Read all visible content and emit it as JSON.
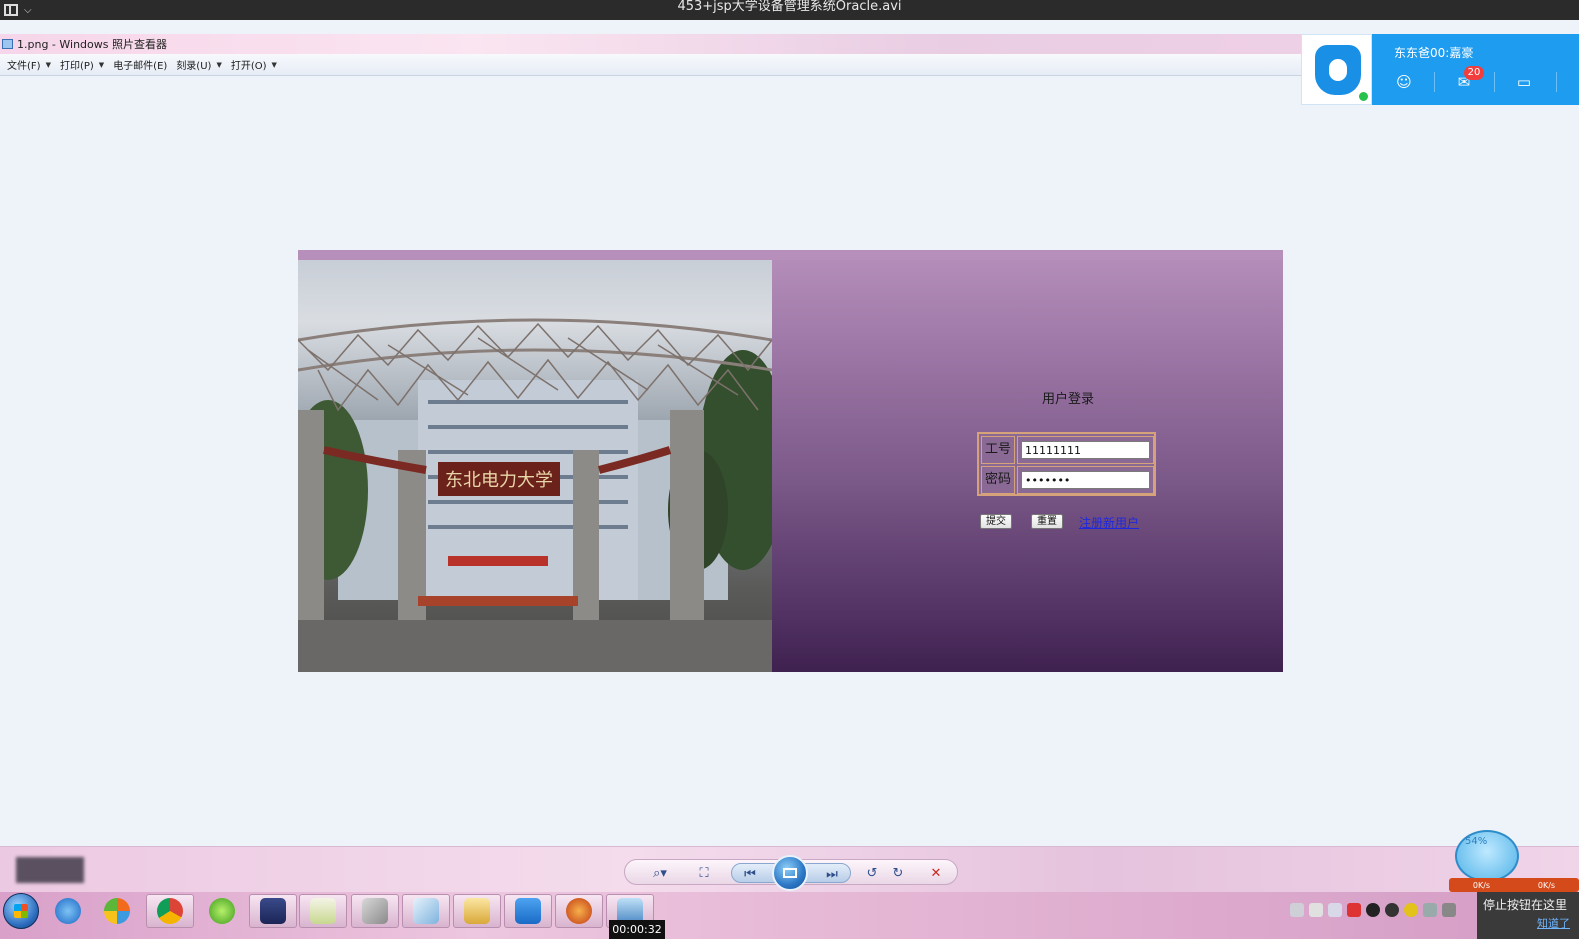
{
  "player": {
    "title": "453+jsp大学设备管理系统Oracle.avi",
    "time": "00:00:32"
  },
  "viewer": {
    "window_title": "1.png - Windows 照片查看器",
    "menu": [
      {
        "label": "文件(F)",
        "caret": "▼"
      },
      {
        "label": "打印(P)",
        "caret": "▼"
      },
      {
        "label": "电子邮件(E)",
        "caret": ""
      },
      {
        "label": "刻录(U)",
        "caret": "▼"
      },
      {
        "label": "打开(O)",
        "caret": "▼"
      }
    ]
  },
  "login": {
    "title": "用户登录",
    "id_label": "工号",
    "id_value": "11111111",
    "pw_label": "密码",
    "pw_value": "•••••••",
    "submit_label": "提交",
    "reset_label": "重置",
    "register_label": "注册新用户",
    "banner_text": "东北电力大学"
  },
  "qq": {
    "name": "东东爸00:嘉豪",
    "badge": "20"
  },
  "net_widget": {
    "percent": "54%",
    "down": "0K/s",
    "up": "0K/s"
  },
  "notice": {
    "text": "停止按钮在这里",
    "link": "知道了"
  },
  "colors": {
    "login_gradient_top": "#b68fbb",
    "login_gradient_bottom": "#3f2150",
    "form_border": "#d6a27a",
    "link": "#1d27e0",
    "qq_blue": "#1e9cf0"
  }
}
